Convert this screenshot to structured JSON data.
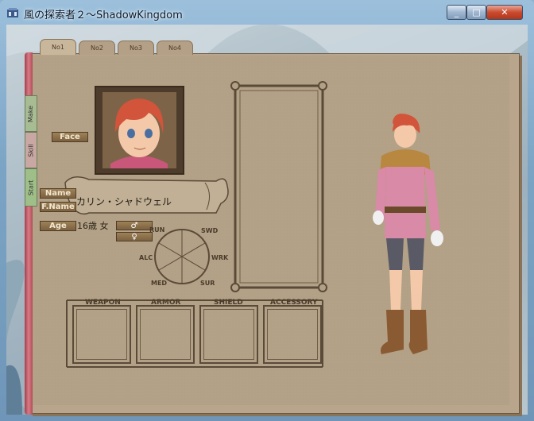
{
  "window": {
    "title": "風の探索者２～ShadowKingdom",
    "minimize": "_",
    "maximize": "□",
    "close": "✕"
  },
  "tabs": [
    "No1",
    "No2",
    "No3",
    "No4"
  ],
  "side_tabs": [
    "Make",
    "Skill",
    "Start"
  ],
  "sheet": {
    "face_label": "Face",
    "name_label": "Name",
    "fname_label": "F.Name",
    "name_value": "カリン・シャドウェル",
    "age_label": "Age",
    "age_value": "16歳 女",
    "male_symbol": "♂",
    "female_symbol": "♀"
  },
  "stats": [
    "RUN",
    "SWD",
    "WRK",
    "SUR",
    "MED",
    "ALC"
  ],
  "equipment": [
    "WEAPON",
    "ARMOR",
    "SHIELD",
    "ACCESSORY"
  ],
  "colors": {
    "page": "#b2a186",
    "label_button": "#8b6d48",
    "spine": "#c4606c"
  }
}
